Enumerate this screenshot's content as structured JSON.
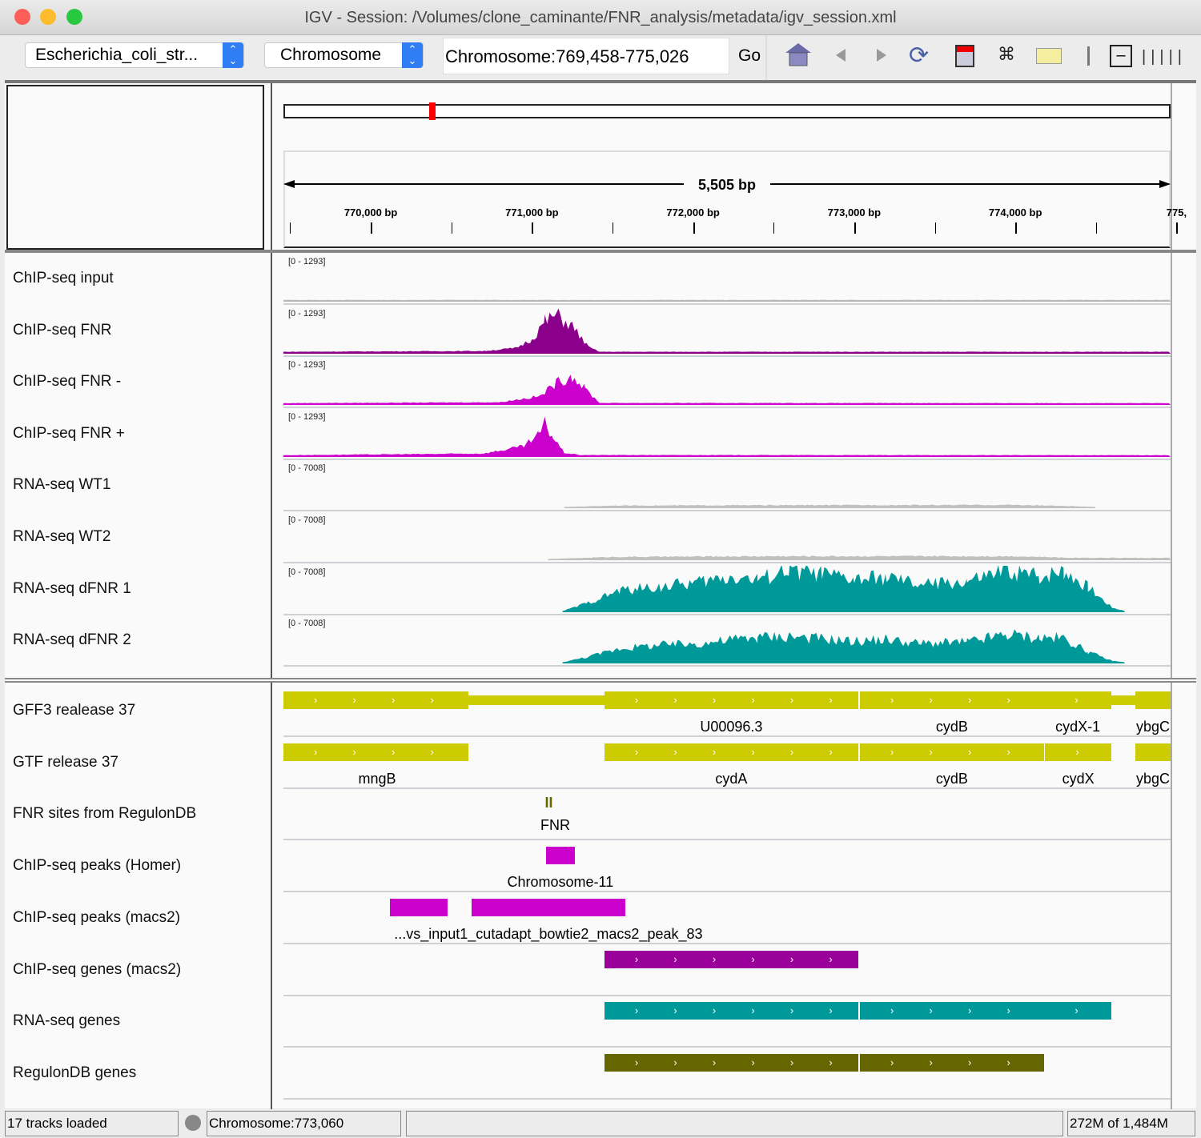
{
  "window": {
    "title": "IGV - Session: /Volumes/clone_caminante/FNR_analysis/metadata/igv_session.xml"
  },
  "toolbar": {
    "genome": "Escherichia_coli_str...",
    "chromosome": "Chromosome",
    "locus": "Chromosome:769,458-775,026",
    "go_label": "Go",
    "icons": [
      "home-icon",
      "back-icon",
      "forward-icon",
      "refresh-icon",
      "region-of-interest-icon",
      "resize-icon",
      "popup-info-icon",
      "zoom-out-icon",
      "zoom-level-icon"
    ]
  },
  "ruler": {
    "span_label": "5,505 bp",
    "start": 769458,
    "end": 774963,
    "ticks": [
      "770,000 bp",
      "771,000 bp",
      "772,000 bp",
      "773,000 bp",
      "774,000 bp",
      "775,"
    ],
    "tick_values": [
      770000,
      771000,
      772000,
      773000,
      774000,
      775000
    ]
  },
  "ideogram": {
    "marker_color": "#ff0000"
  },
  "data_tracks": [
    {
      "name": "ChIP-seq input",
      "range": "[0 - 1293]",
      "max": 1293,
      "color": "#b8b8b8",
      "profile": [
        [
          769458,
          15
        ],
        [
          774963,
          15
        ]
      ]
    },
    {
      "name": "ChIP-seq FNR",
      "range": "[0 - 1293]",
      "max": 1293,
      "color": "#8b008b",
      "profile": [
        [
          769458,
          20
        ],
        [
          770700,
          40
        ],
        [
          770900,
          120
        ],
        [
          771000,
          350
        ],
        [
          771080,
          820
        ],
        [
          771150,
          1000
        ],
        [
          771250,
          700
        ],
        [
          771350,
          150
        ],
        [
          771420,
          20
        ],
        [
          774963,
          20
        ]
      ]
    },
    {
      "name": "ChIP-seq FNR -",
      "range": "[0 - 1293]",
      "max": 1293,
      "color": "#cc00cc",
      "profile": [
        [
          769458,
          15
        ],
        [
          770800,
          40
        ],
        [
          771050,
          200
        ],
        [
          771150,
          550
        ],
        [
          771250,
          750
        ],
        [
          771330,
          400
        ],
        [
          771420,
          20
        ],
        [
          774963,
          15
        ]
      ]
    },
    {
      "name": "ChIP-seq FNR +",
      "range": "[0 - 1293]",
      "max": 1293,
      "color": "#cc00cc",
      "profile": [
        [
          769458,
          15
        ],
        [
          770700,
          60
        ],
        [
          770950,
          250
        ],
        [
          771040,
          550
        ],
        [
          771080,
          850
        ],
        [
          771130,
          500
        ],
        [
          771200,
          80
        ],
        [
          771300,
          20
        ],
        [
          774963,
          15
        ]
      ]
    },
    {
      "name": "RNA-seq WT1",
      "range": "[0 - 7008]",
      "max": 7008,
      "color": "#c0c0c0",
      "profile": [
        [
          771200,
          0
        ],
        [
          771500,
          200
        ],
        [
          772500,
          260
        ],
        [
          774000,
          300
        ],
        [
          774300,
          150
        ],
        [
          774500,
          0
        ]
      ]
    },
    {
      "name": "RNA-seq WT2",
      "range": "[0 - 7008]",
      "max": 7008,
      "color": "#c0c0c0",
      "profile": [
        [
          771100,
          0
        ],
        [
          771500,
          300
        ],
        [
          772500,
          400
        ],
        [
          774000,
          400
        ],
        [
          774300,
          200
        ],
        [
          774963,
          150
        ]
      ]
    },
    {
      "name": "RNA-seq dFNR 1",
      "range": "[0 - 7008]",
      "max": 7008,
      "color": "#009999",
      "profile": [
        [
          771190,
          0
        ],
        [
          771350,
          1200
        ],
        [
          771550,
          3000
        ],
        [
          771800,
          3500
        ],
        [
          772050,
          4200
        ],
        [
          772250,
          5000
        ],
        [
          772400,
          4500
        ],
        [
          772600,
          6000
        ],
        [
          772800,
          5300
        ],
        [
          773000,
          4500
        ],
        [
          773200,
          4800
        ],
        [
          773400,
          3800
        ],
        [
          773700,
          4200
        ],
        [
          773950,
          5800
        ],
        [
          774150,
          5000
        ],
        [
          774300,
          5900
        ],
        [
          774450,
          3500
        ],
        [
          774600,
          500
        ],
        [
          774680,
          0
        ]
      ]
    },
    {
      "name": "RNA-seq dFNR 2",
      "range": "[0 - 7008]",
      "max": 7008,
      "color": "#009999",
      "profile": [
        [
          771190,
          0
        ],
        [
          771350,
          800
        ],
        [
          771550,
          2000
        ],
        [
          771800,
          2500
        ],
        [
          772050,
          2700
        ],
        [
          772250,
          3300
        ],
        [
          772400,
          3600
        ],
        [
          772600,
          3800
        ],
        [
          772800,
          3400
        ],
        [
          773000,
          3000
        ],
        [
          773200,
          3300
        ],
        [
          773400,
          2700
        ],
        [
          773700,
          2900
        ],
        [
          773950,
          4000
        ],
        [
          774150,
          3500
        ],
        [
          774300,
          3500
        ],
        [
          774450,
          1500
        ],
        [
          774600,
          200
        ],
        [
          774680,
          0
        ]
      ]
    }
  ],
  "feature_tracks": [
    {
      "name": "GFF3 realease 37",
      "color": "#cccc00",
      "features": [
        {
          "start": 769458,
          "end": 770606,
          "label": "",
          "strand": "+"
        },
        {
          "start": 770606,
          "end": 771450,
          "label": "",
          "thin": true
        },
        {
          "start": 771450,
          "end": 773025,
          "label": "U00096.3",
          "strand": "+"
        },
        {
          "start": 773035,
          "end": 774177,
          "label": "cydB",
          "strand": "+"
        },
        {
          "start": 774180,
          "end": 774595,
          "label": "cydX-1",
          "strand": "+"
        },
        {
          "start": 774595,
          "end": 774744,
          "label": "",
          "thin": true
        },
        {
          "start": 774744,
          "end": 774963,
          "label": "ybgC"
        }
      ]
    },
    {
      "name": "GTF release 37",
      "color": "#cccc00",
      "features": [
        {
          "start": 769458,
          "end": 770606,
          "label": "mngB",
          "strand": "+"
        },
        {
          "start": 771450,
          "end": 773025,
          "label": "cydA",
          "strand": "+"
        },
        {
          "start": 773035,
          "end": 774177,
          "label": "cydB",
          "strand": "+"
        },
        {
          "start": 774185,
          "end": 774595,
          "label": "cydX",
          "strand": "+"
        },
        {
          "start": 774744,
          "end": 774963,
          "label": "ybgC"
        }
      ]
    },
    {
      "name": "FNR sites from RegulonDB",
      "color": "#666600",
      "features": [
        {
          "start": 771120,
          "end": 771150,
          "label": "FNR",
          "site": true
        }
      ]
    },
    {
      "name": "ChIP-seq peaks (Homer)",
      "color": "#cc00cc",
      "features": [
        {
          "start": 771087,
          "end": 771266,
          "label": "Chromosome-11",
          "strand": "+"
        }
      ]
    },
    {
      "name": "ChIP-seq peaks (macs2)",
      "color": "#cc00cc",
      "features": [
        {
          "start": 770119,
          "end": 770476,
          "label": ""
        },
        {
          "start": 770625,
          "end": 771579,
          "label": "...vs_input1_cutadapt_bowtie2_macs2_peak_83"
        }
      ]
    },
    {
      "name": "ChIP-seq genes (macs2)",
      "color": "#990099",
      "features": [
        {
          "start": 771450,
          "end": 773025,
          "label": "",
          "strand": "+"
        }
      ]
    },
    {
      "name": "RNA-seq genes",
      "color": "#009999",
      "features": [
        {
          "start": 771450,
          "end": 773025,
          "label": "",
          "strand": "+"
        },
        {
          "start": 773035,
          "end": 774177,
          "label": "",
          "strand": "+"
        },
        {
          "start": 774180,
          "end": 774595,
          "label": "",
          "strand": "+"
        }
      ]
    },
    {
      "name": "RegulonDB genes",
      "color": "#666600",
      "features": [
        {
          "start": 771450,
          "end": 773025,
          "label": "",
          "strand": "+"
        },
        {
          "start": 773035,
          "end": 774177,
          "label": "",
          "strand": "+"
        }
      ]
    }
  ],
  "status": {
    "tracks_loaded": "17 tracks loaded",
    "position": "Chromosome:773,060",
    "memory": "272M of 1,484M"
  }
}
